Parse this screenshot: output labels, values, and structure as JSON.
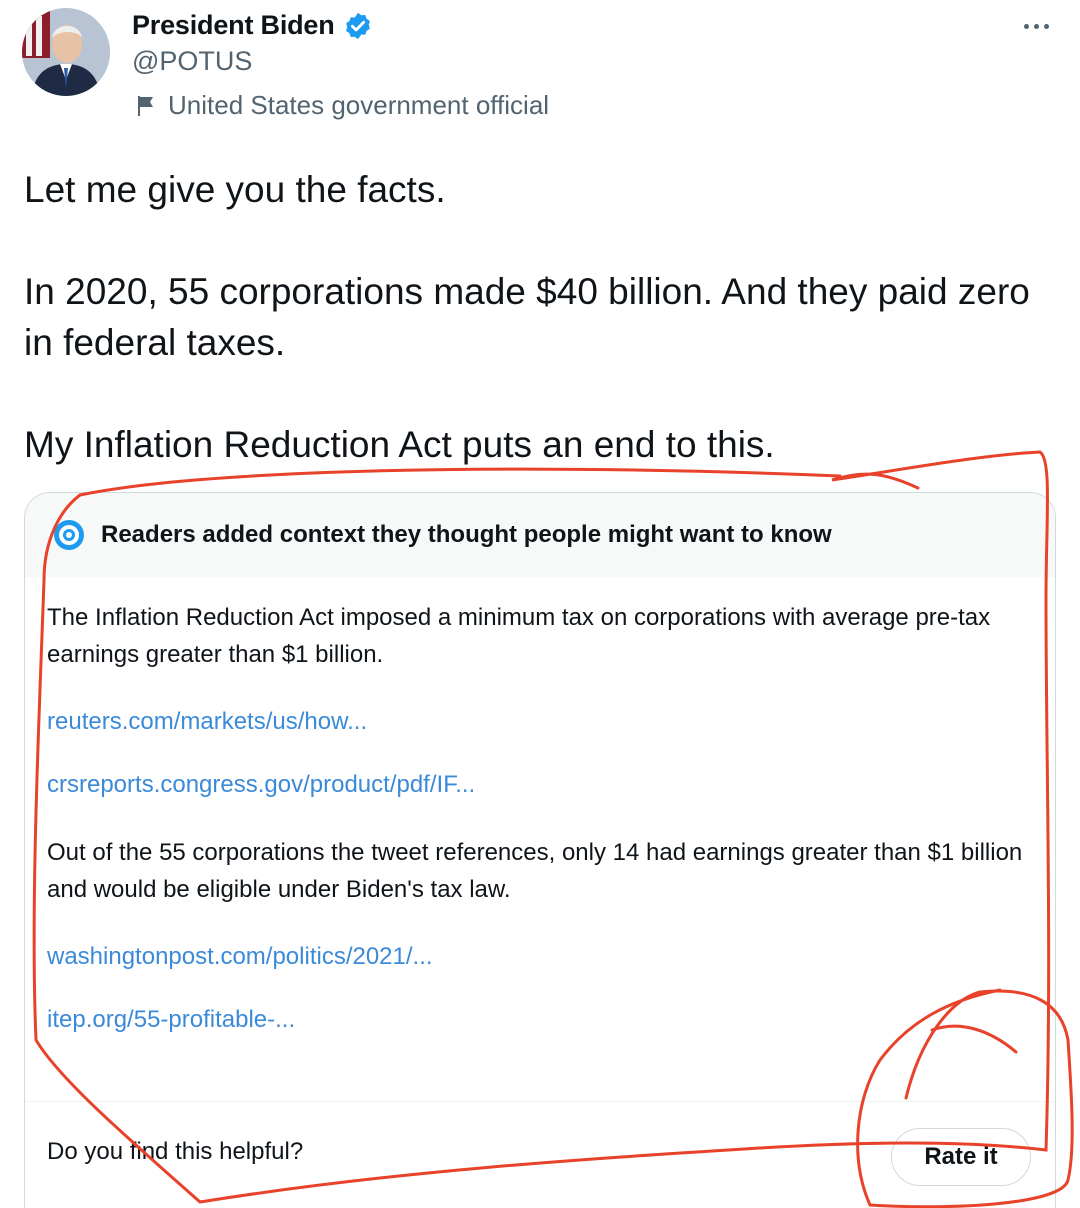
{
  "author": {
    "display_name": "President Biden",
    "handle": "@POTUS",
    "label": "United States government official"
  },
  "tweet": {
    "paragraphs": [
      "Let me give you the facts.",
      "In 2020, 55 corporations made $40 billion. And they paid zero in federal taxes.",
      "My Inflation Reduction Act puts an end to this."
    ]
  },
  "note": {
    "header": "Readers added context they thought people might want to know",
    "para1": "The Inflation Reduction Act imposed a minimum tax on corporations with average pre-tax earnings greater than $1 billion.",
    "links1": [
      "reuters.com/markets/us/how...",
      "crsreports.congress.gov/product/pdf/IF..."
    ],
    "para2": "Out of the 55 corporations the tweet references, only 14 had earnings greater than $1 billion and would be eligible under Biden's tax law.",
    "links2": [
      "washingtonpost.com/politics/2021/...",
      "itep.org/55-profitable-..."
    ],
    "footer_question": "Do you find this helpful?",
    "rate_button": "Rate it"
  },
  "icons": {
    "verified": "verified-badge-icon",
    "flag": "flag-icon",
    "more": "more-options-icon",
    "context": "community-notes-icon"
  },
  "colors": {
    "link": "#3b8ad9",
    "verified": "#1d9bf0",
    "annotation": "#e8422a"
  }
}
